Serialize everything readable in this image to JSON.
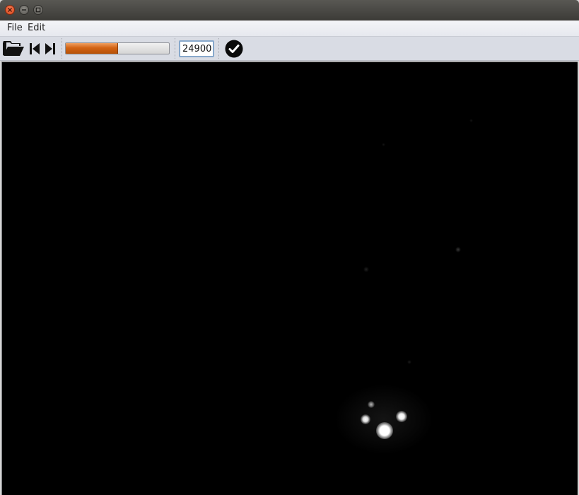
{
  "window": {
    "controls": [
      "close-icon",
      "minimize-icon",
      "maximize-icon"
    ]
  },
  "menubar": {
    "items": [
      {
        "label": "File"
      },
      {
        "label": "Edit"
      }
    ]
  },
  "toolbar": {
    "open_icon": "folder-open-icon",
    "prev_icon": "skip-back-icon",
    "next_icon": "skip-forward-icon",
    "progress_fraction": 0.5,
    "progress_color": "#d26314",
    "frame_value": "24900",
    "confirm_icon": "checkmark-circle-icon"
  },
  "viewer": {
    "background": "#000000"
  }
}
